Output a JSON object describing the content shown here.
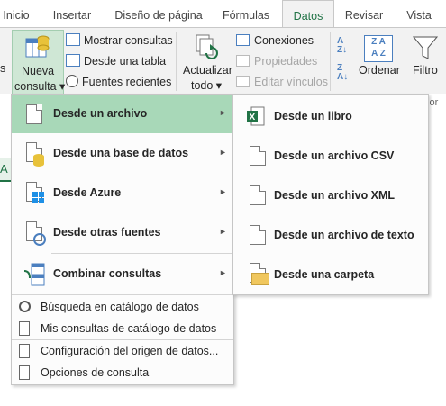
{
  "tabs": [
    "Inicio",
    "Insertar",
    "Diseño de página",
    "Fórmulas",
    "Datos",
    "Revisar",
    "Vista"
  ],
  "active_tab": "Datos",
  "ribbon": {
    "nueva_consulta": [
      "Nueva",
      "consulta ▾"
    ],
    "mostrar_consultas": "Mostrar consultas",
    "desde_una_tabla": "Desde una tabla",
    "fuentes_recientes": "Fuentes recientes",
    "actualizar_todo": [
      "Actualizar",
      "todo ▾"
    ],
    "conexiones": "Conexiones",
    "propiedades": "Propiedades",
    "editar_vinculos": "Editar vínculos",
    "ordenar": "Ordenar",
    "filtro": "Filtro",
    "clipped_right": "var por"
  },
  "sheet": {
    "column_letter": "A"
  },
  "main_menu": {
    "items": [
      {
        "label": "Desde un archivo",
        "has_submenu": true
      },
      {
        "label": "Desde una base de datos",
        "has_submenu": true
      },
      {
        "label": "Desde Azure",
        "has_submenu": true
      },
      {
        "label": "Desde otras fuentes",
        "has_submenu": true
      },
      {
        "label": "Combinar consultas",
        "has_submenu": true
      }
    ],
    "commands": [
      "Búsqueda en catálogo de datos",
      "Mis consultas de catálogo de datos",
      "Configuración del origen de datos...",
      "Opciones de consulta"
    ]
  },
  "sub_menu": {
    "items": [
      "Desde un libro",
      "Desde un archivo CSV",
      "Desde un archivo XML",
      "Desde un archivo de texto",
      "Desde una carpeta"
    ]
  },
  "colors": {
    "accent": "#217346",
    "highlight": "#a8d8b8",
    "ribbon_bg": "#f2f2f2"
  }
}
